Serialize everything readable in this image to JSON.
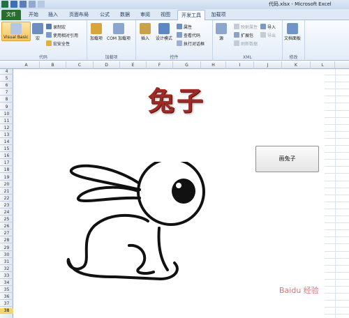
{
  "window": {
    "title": "代码.xlsx - Microsoft Excel"
  },
  "tabs": [
    "文件",
    "开始",
    "插入",
    "页面布局",
    "公式",
    "数据",
    "审阅",
    "视图",
    "开发工具",
    "加载项"
  ],
  "ribbon": {
    "code": {
      "label": "代码",
      "visual_basic": "Visual Basic",
      "macro": "宏",
      "record": "录制宏",
      "relative": "使用相对引用",
      "security": "宏安全性"
    },
    "addins": {
      "label": "加载项",
      "addins": "加载项",
      "com": "COM 加载项"
    },
    "controls": {
      "label": "控件",
      "insert": "插入",
      "design": "设计模式",
      "properties": "属性",
      "view_code": "查看代码",
      "dialog": "执行对话框"
    },
    "xml": {
      "label": "XML",
      "source": "源",
      "map_props": "映射属性",
      "expansion": "扩展包",
      "refresh": "刷新数据",
      "import": "导入",
      "export": "导出"
    },
    "modify": {
      "label": "修改",
      "doc_panel": "文档面板"
    }
  },
  "columns": [
    "A",
    "B",
    "C",
    "D",
    "E",
    "F",
    "G",
    "H",
    "I",
    "J",
    "K",
    "L"
  ],
  "rows": [
    "4",
    "5",
    "6",
    "7",
    "8",
    "9",
    "10",
    "11",
    "12",
    "13",
    "14",
    "15",
    "16",
    "17",
    "18",
    "19",
    "20",
    "21",
    "22",
    "23",
    "24",
    "25",
    "26",
    "27",
    "28",
    "29",
    "30",
    "31",
    "32",
    "33",
    "34",
    "35",
    "36",
    "37",
    "38"
  ],
  "selected_row": "38",
  "sheet": {
    "title_art": "兔子",
    "draw_button": "画兔子"
  },
  "watermark": "Baidu 经验"
}
